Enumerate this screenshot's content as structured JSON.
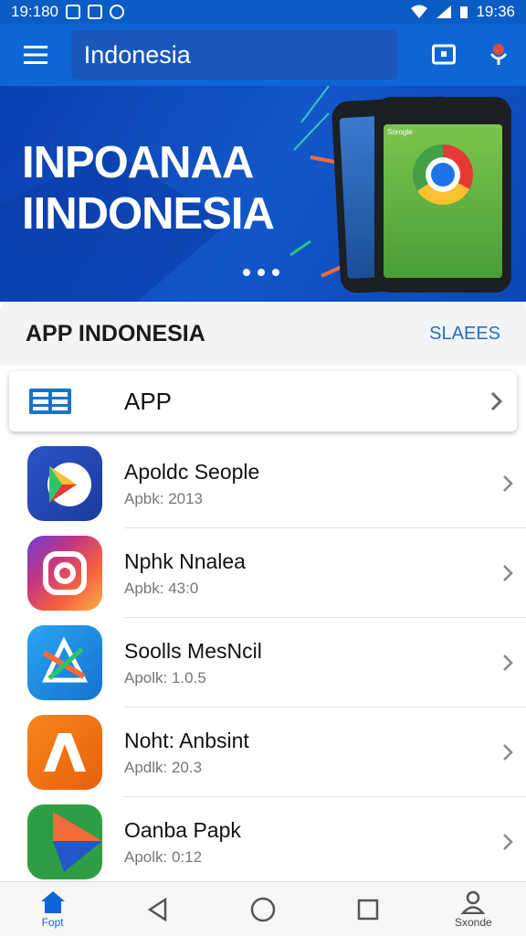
{
  "status_bar": {
    "time_left": "19:180",
    "time_right": "19:36"
  },
  "app_bar": {
    "search_text": "Indonesia"
  },
  "hero": {
    "title_line1": "INPOANAA",
    "title_line2": "IINDONESIA",
    "phone_header": "Sorogle"
  },
  "section": {
    "title": "APP INDONESIA",
    "link": "SLAEES"
  },
  "category_row": {
    "label": "APP"
  },
  "apps": [
    {
      "name": "Apoldc Seople",
      "sub": "Apbk: 2013",
      "icon": "play-arrow-icon"
    },
    {
      "name": "Nphk Nnalea",
      "sub": "Apbk: 43:0",
      "icon": "instagram-like-icon"
    },
    {
      "name": "Soolls MesNcil",
      "sub": "Apolk: 1.0.5",
      "icon": "star-arrow-icon"
    },
    {
      "name": "Noht: Anbsint",
      "sub": "Apdlk: 20.3",
      "icon": "m-logo-icon"
    },
    {
      "name": "Oanba Papk",
      "sub": "Apolk: 0:12",
      "icon": "colored-arrow-icon"
    }
  ],
  "bottom_nav": [
    {
      "label": "Fopt",
      "icon": "home-icon",
      "active": true
    },
    {
      "label": "",
      "icon": "back-triangle-icon",
      "active": false
    },
    {
      "label": "",
      "icon": "home-circle-icon",
      "active": false
    },
    {
      "label": "",
      "icon": "recents-square-icon",
      "active": false
    },
    {
      "label": "Sxonde",
      "icon": "person-icon",
      "active": false
    }
  ],
  "colors": {
    "primary": "#0e66d6",
    "hero": "#0b4fc0",
    "link": "#1a73c8"
  }
}
